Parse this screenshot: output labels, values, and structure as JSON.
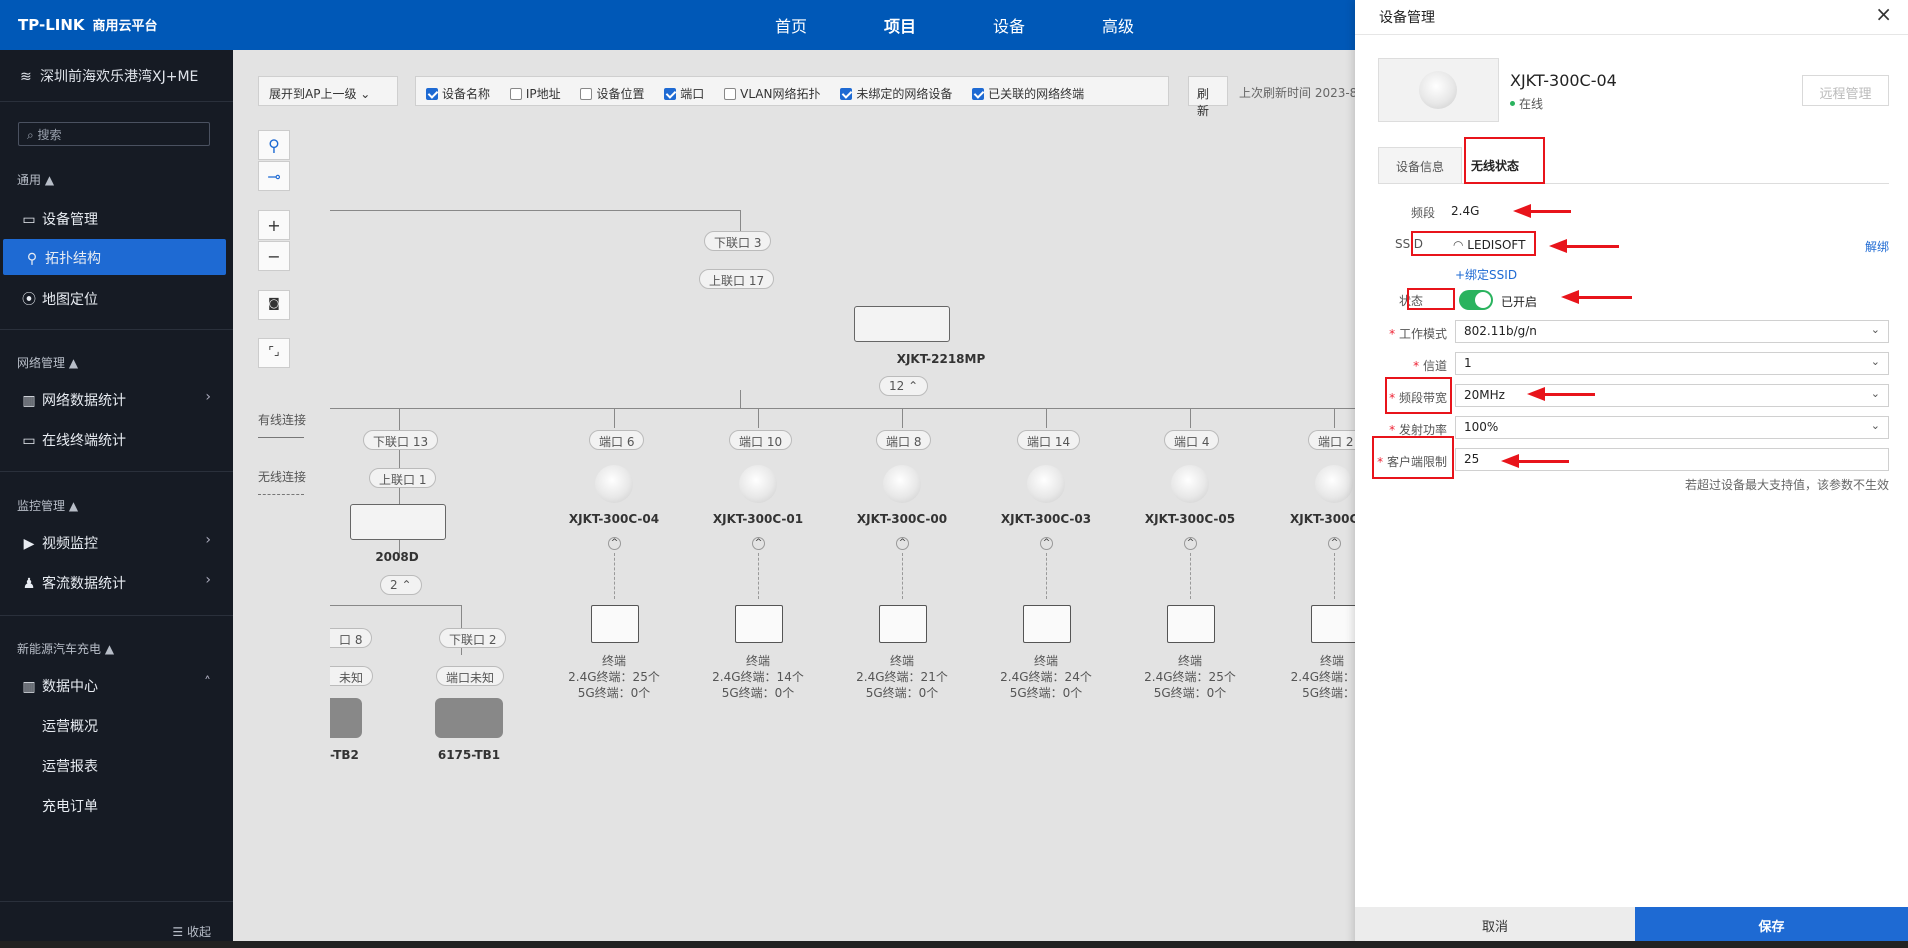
{
  "topbar": {
    "logo_brand": "TP-LINK",
    "logo_product": "商用云平台",
    "nav": [
      "首页",
      "项目",
      "设备",
      "高级"
    ],
    "active_nav": "项目"
  },
  "sidebar": {
    "org": "深圳前海欢乐港湾XJ+ME",
    "search_placeholder": "搜索",
    "sections": {
      "general": "通用 ▲",
      "network": "网络管理 ▲",
      "monitor": "监控管理 ▲",
      "ev": "新能源汽车充电 ▲"
    },
    "items": {
      "device_mgmt": "设备管理",
      "topology": "拓扑结构",
      "map": "地图定位",
      "net_stats": "网络数据统计",
      "online_terms": "在线终端统计",
      "video": "视频监控",
      "traffic": "客流数据统计",
      "datacenter": "数据中心"
    },
    "sub_items": [
      "运营概况",
      "运营报表",
      "充电订单"
    ],
    "collapse": "收起"
  },
  "toolbar": {
    "expand_select": "展开到AP上一级",
    "options": [
      {
        "label": "设备名称",
        "checked": true
      },
      {
        "label": "IP地址",
        "checked": false
      },
      {
        "label": "设备位置",
        "checked": false
      },
      {
        "label": "端口",
        "checked": true
      },
      {
        "label": "VLAN网络拓扑",
        "checked": false
      },
      {
        "label": "未绑定的网络设备",
        "checked": true
      },
      {
        "label": "已关联的网络终端",
        "checked": true
      }
    ],
    "refresh": "刷新",
    "last_refresh": "上次刷新时间 2023-8"
  },
  "legend": {
    "wired": "有线连接",
    "wireless": "无线连接"
  },
  "topology": {
    "core": {
      "down_port": "下联口 3",
      "up_port": "上联口 17",
      "name": "XJKT-2218MP",
      "collapse": "12 ⌃"
    },
    "switch2008": {
      "down_port": "下联口 13",
      "up_port": "上联口 1",
      "name": "2008D",
      "collapse": "2 ⌃"
    },
    "left_nodes": [
      {
        "port": "口 8",
        "uplink": "未知",
        "name": "-TB2"
      },
      {
        "port": "下联口 2",
        "uplink": "端口未知",
        "name": "6175-TB1"
      }
    ],
    "aps": [
      {
        "port": "端口 6",
        "name": "XJKT-300C-04",
        "term": "终端",
        "t24": "2.4G终端：25个",
        "t5": "5G终端：0个"
      },
      {
        "port": "端口 10",
        "name": "XJKT-300C-01",
        "term": "终端",
        "t24": "2.4G终端：14个",
        "t5": "5G终端：0个"
      },
      {
        "port": "端口 8",
        "name": "XJKT-300C-00",
        "term": "终端",
        "t24": "2.4G终端：21个",
        "t5": "5G终端：0个"
      },
      {
        "port": "端口 14",
        "name": "XJKT-300C-03",
        "term": "终端",
        "t24": "2.4G终端：24个",
        "t5": "5G终端：0个"
      },
      {
        "port": "端口 4",
        "name": "XJKT-300C-05",
        "term": "终端",
        "t24": "2.4G终端：25个",
        "t5": "5G终端：0个"
      },
      {
        "port": "端口 2",
        "name": "XJKT-300C",
        "term": "终端",
        "t24": "2.4G终端：",
        "t5": "5G终端："
      }
    ]
  },
  "panel": {
    "title": "设备管理",
    "close": "×",
    "device_name": "XJKT-300C-04",
    "status": "在线",
    "remote_btn": "远程管理",
    "tabs": [
      "设备信息",
      "无线状态"
    ],
    "band_label": "频段",
    "band_value": "2.4G",
    "ssid_label": "SSID",
    "ssid_value": "LEDISOFT",
    "unbind": "解绑",
    "bind_ssid": "+绑定SSID",
    "state_label": "状态",
    "state_value": "已开启",
    "fields": [
      {
        "label": "工作模式",
        "value": "802.11b/g/n"
      },
      {
        "label": "信道",
        "value": "1"
      },
      {
        "label": "频段带宽",
        "value": "20MHz"
      },
      {
        "label": "发射功率",
        "value": "100%"
      },
      {
        "label": "客户端限制",
        "value": "25"
      }
    ],
    "hint": "若超过设备最大支持值，该参数不生效",
    "cancel": "取消",
    "save": "保存"
  },
  "colors": {
    "brand": "#0058b7",
    "accent": "#1e6ad3",
    "annotation": "#e8141b",
    "online": "#2ab35e"
  }
}
